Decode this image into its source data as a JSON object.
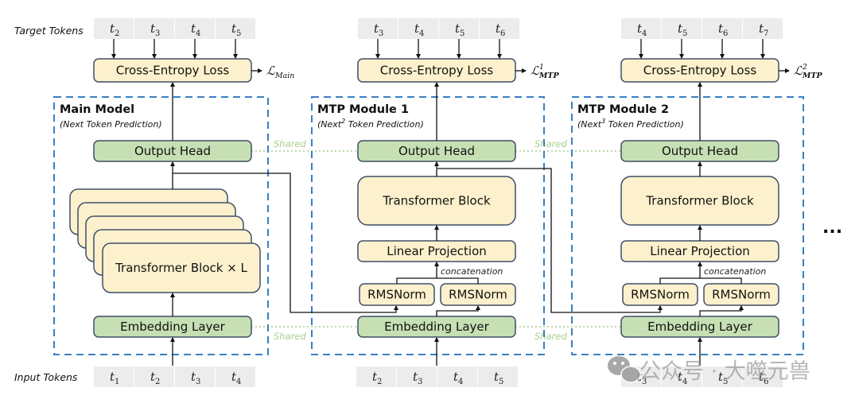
{
  "side_labels": {
    "target_tokens": "Target Tokens",
    "input_tokens": "Input Tokens"
  },
  "colors": {
    "module_border": "#3a7fc4",
    "loss_fill": "#fdf1cd",
    "head_fill": "#c6e0b4",
    "token_fill": "#ececec",
    "box_stroke": "#3f4f66",
    "shared_color": "#a8d08d"
  },
  "columns": [
    {
      "id": "main",
      "title": "Main Model",
      "subtitle": "(Next Token Prediction)",
      "target_tokens": [
        {
          "base": "t",
          "sub": "2"
        },
        {
          "base": "t",
          "sub": "3"
        },
        {
          "base": "t",
          "sub": "4"
        },
        {
          "base": "t",
          "sub": "5"
        }
      ],
      "input_tokens": [
        {
          "base": "t",
          "sub": "1"
        },
        {
          "base": "t",
          "sub": "2"
        },
        {
          "base": "t",
          "sub": "3"
        },
        {
          "base": "t",
          "sub": "4"
        }
      ],
      "loss_box": "Cross-Entropy Loss",
      "loss_symbol": {
        "base": "ℒ",
        "sub": "Main",
        "sup": ""
      },
      "output_head": "Output Head",
      "transformer": "Transformer Block × L",
      "embedding": "Embedding Layer"
    },
    {
      "id": "mtp1",
      "title": "MTP Module 1",
      "subtitle_pre": "(Next",
      "subtitle_sup": "2",
      "subtitle_post": " Token Prediction)",
      "target_tokens": [
        {
          "base": "t",
          "sub": "3"
        },
        {
          "base": "t",
          "sub": "4"
        },
        {
          "base": "t",
          "sub": "5"
        },
        {
          "base": "t",
          "sub": "6"
        }
      ],
      "input_tokens": [
        {
          "base": "t",
          "sub": "2"
        },
        {
          "base": "t",
          "sub": "3"
        },
        {
          "base": "t",
          "sub": "4"
        },
        {
          "base": "t",
          "sub": "5"
        }
      ],
      "loss_box": "Cross-Entropy Loss",
      "loss_symbol": {
        "base": "ℒ",
        "sub": "MTP",
        "sup": "1"
      },
      "output_head": "Output Head",
      "transformer": "Transformer Block",
      "linear_projection": "Linear Projection",
      "concatenation": "concatenation",
      "rmsnorm": [
        "RMSNorm",
        "RMSNorm"
      ],
      "embedding": "Embedding Layer"
    },
    {
      "id": "mtp2",
      "title": "MTP Module 2",
      "subtitle_pre": "(Next",
      "subtitle_sup": "3",
      "subtitle_post": " Token Prediction)",
      "target_tokens": [
        {
          "base": "t",
          "sub": "4"
        },
        {
          "base": "t",
          "sub": "5"
        },
        {
          "base": "t",
          "sub": "6"
        },
        {
          "base": "t",
          "sub": "7"
        }
      ],
      "input_tokens": [
        {
          "base": "t",
          "sub": "3"
        },
        {
          "base": "t",
          "sub": "4"
        },
        {
          "base": "t",
          "sub": "5"
        },
        {
          "base": "t",
          "sub": "6"
        }
      ],
      "loss_box": "Cross-Entropy Loss",
      "loss_symbol": {
        "base": "ℒ",
        "sub": "MTP",
        "sup": "2"
      },
      "output_head": "Output Head",
      "transformer": "Transformer Block",
      "linear_projection": "Linear Projection",
      "concatenation": "concatenation",
      "rmsnorm": [
        "RMSNorm",
        "RMSNorm"
      ],
      "embedding": "Embedding Layer"
    }
  ],
  "shared_label": "Shared",
  "ellipsis": "...",
  "watermark": "公众号 · 大噬元兽"
}
